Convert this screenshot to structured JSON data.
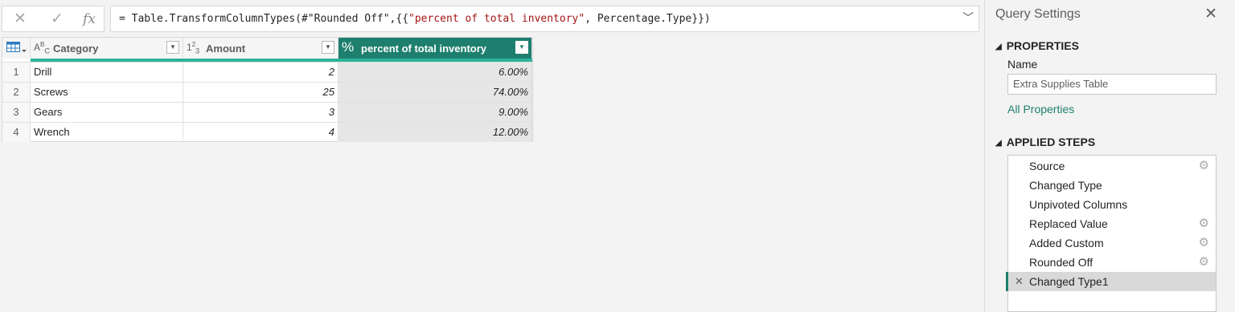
{
  "formula_bar": {
    "icons": [
      "close-icon",
      "check-icon",
      "fx-icon"
    ],
    "fx_label": "fx",
    "formula_prefix": "= Table.TransformColumnTypes(#\"Rounded Off\",{{",
    "formula_string": "\"percent of total inventory\"",
    "formula_suffix": ", Percentage.Type}})"
  },
  "table": {
    "columns": [
      {
        "type_icon": "ABC",
        "label": "Category"
      },
      {
        "type_icon": "123",
        "label": "Amount"
      },
      {
        "type_icon": "%",
        "label": "percent of total inventory"
      }
    ],
    "rows": [
      {
        "num": "1",
        "category": "Drill",
        "amount": "2",
        "percent": "6.00%"
      },
      {
        "num": "2",
        "category": "Screws",
        "amount": "25",
        "percent": "74.00%"
      },
      {
        "num": "3",
        "category": "Gears",
        "amount": "3",
        "percent": "9.00%"
      },
      {
        "num": "4",
        "category": "Wrench",
        "amount": "4",
        "percent": "12.00%"
      }
    ],
    "colors": {
      "selected_header": "#1e7f6e",
      "quality_bar": "#2bb39b"
    }
  },
  "query_settings": {
    "title": "Query Settings",
    "properties_heading": "PROPERTIES",
    "name_label": "Name",
    "name_value": "Extra Supplies Table",
    "all_properties_link": "All Properties",
    "applied_steps_heading": "APPLIED STEPS",
    "steps": [
      {
        "label": "Source",
        "has_gear": true
      },
      {
        "label": "Changed Type",
        "has_gear": false
      },
      {
        "label": "Unpivoted Columns",
        "has_gear": false
      },
      {
        "label": "Replaced Value",
        "has_gear": true
      },
      {
        "label": "Added Custom",
        "has_gear": true
      },
      {
        "label": "Rounded Off",
        "has_gear": true
      },
      {
        "label": "Changed Type1",
        "has_gear": false,
        "active": true
      }
    ]
  }
}
